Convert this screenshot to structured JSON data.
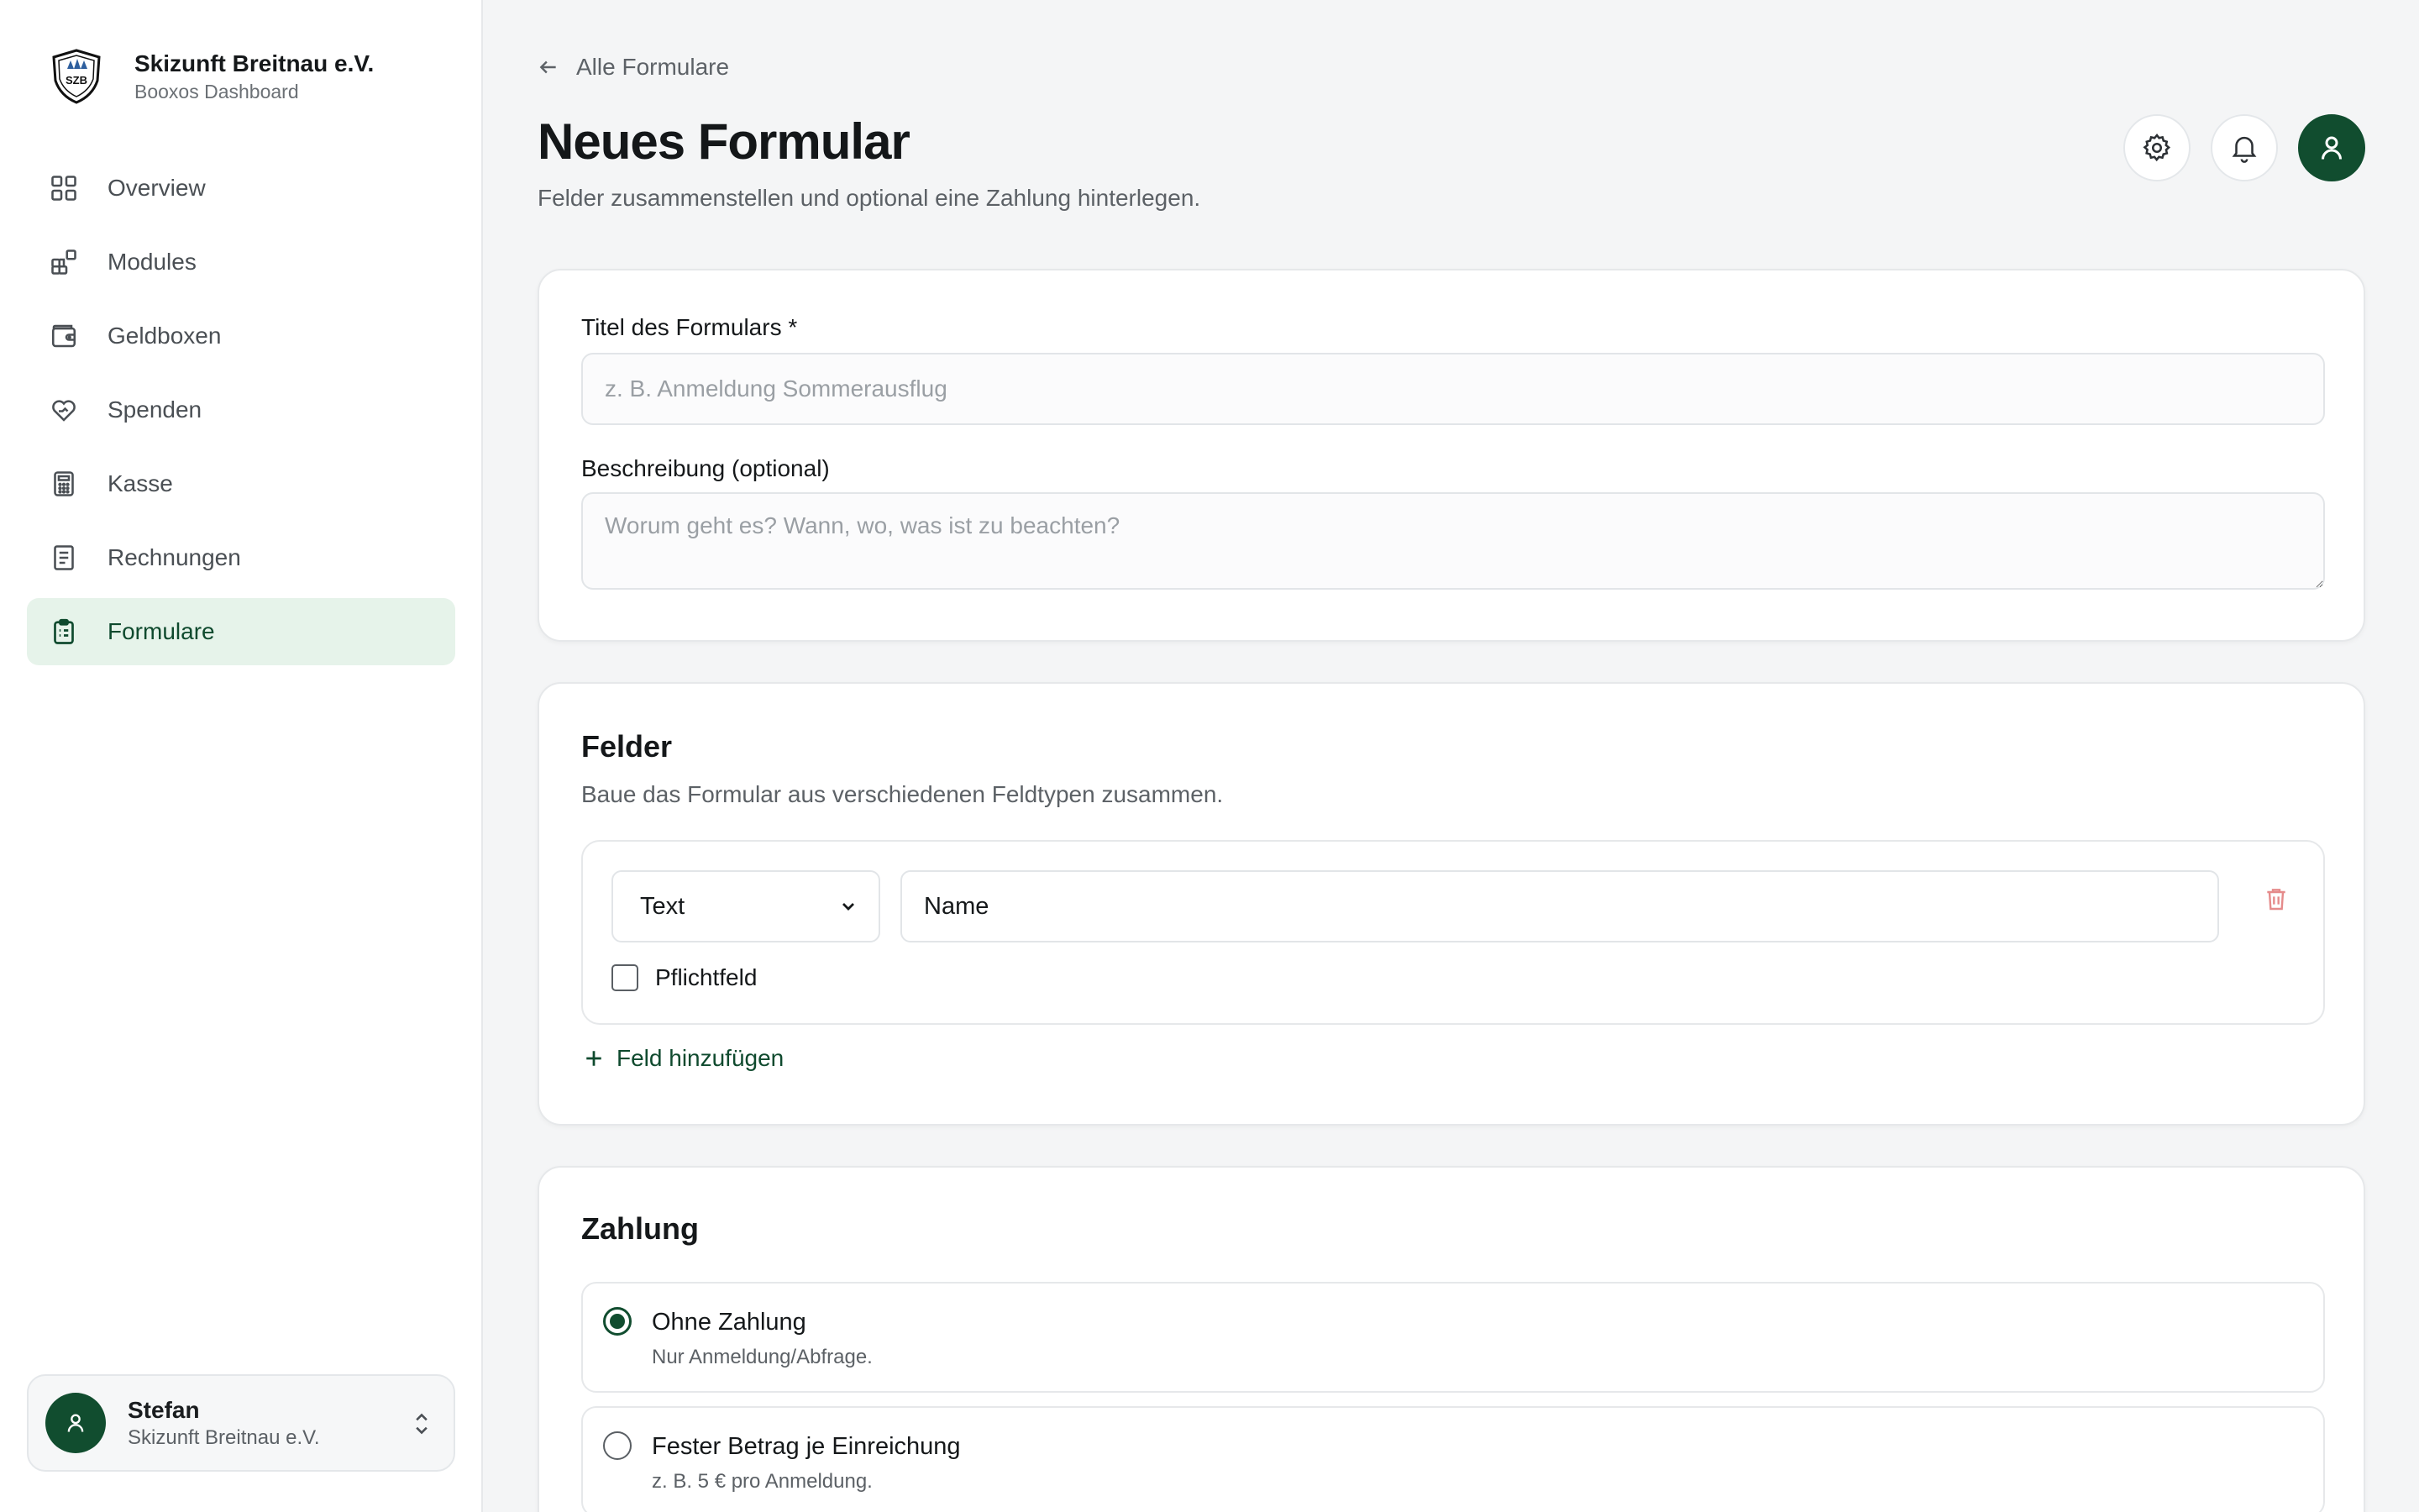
{
  "brand": {
    "name": "Skizunft Breitnau e.V.",
    "subtitle": "Booxos Dashboard",
    "logo_icon": "club-crest-icon",
    "logo_text": "SZB"
  },
  "nav": {
    "items": [
      {
        "label": "Overview",
        "icon": "grid-icon"
      },
      {
        "label": "Modules",
        "icon": "modules-icon"
      },
      {
        "label": "Geldboxen",
        "icon": "wallet-icon"
      },
      {
        "label": "Spenden",
        "icon": "heart-hand-icon"
      },
      {
        "label": "Kasse",
        "icon": "calculator-icon"
      },
      {
        "label": "Rechnungen",
        "icon": "receipt-icon"
      },
      {
        "label": "Formulare",
        "icon": "clipboard-icon",
        "active": true
      }
    ]
  },
  "user": {
    "name": "Stefan",
    "org": "Skizunft Breitnau e.V."
  },
  "header": {
    "back_label": "Alle Formulare",
    "title": "Neues Formular",
    "subtitle": "Felder zusammenstellen und optional eine Zahlung hinterlegen."
  },
  "form_meta": {
    "title_label": "Titel des Formulars *",
    "title_placeholder": "z. B. Anmeldung Sommerausflug",
    "title_value": "",
    "desc_label": "Beschreibung (optional)",
    "desc_placeholder": "Worum geht es? Wann, wo, was ist zu beachten?",
    "desc_value": ""
  },
  "fields_section": {
    "title": "Felder",
    "subtitle": "Baue das Formular aus verschiedenen Feldtypen zusammen.",
    "fields": [
      {
        "type": "Text",
        "name": "Name",
        "required_label": "Pflichtfeld",
        "required": false
      }
    ],
    "add_label": "Feld hinzufügen"
  },
  "payment_section": {
    "title": "Zahlung",
    "options": [
      {
        "title": "Ohne Zahlung",
        "desc": "Nur Anmeldung/Abfrage.",
        "selected": true
      },
      {
        "title": "Fester Betrag je Einreichung",
        "desc": "z. B. 5 € pro Anmeldung.",
        "selected": false
      }
    ]
  },
  "colors": {
    "accent": "#114d2f",
    "active_bg": "#e6f3ea",
    "danger": "#e58b8b"
  }
}
